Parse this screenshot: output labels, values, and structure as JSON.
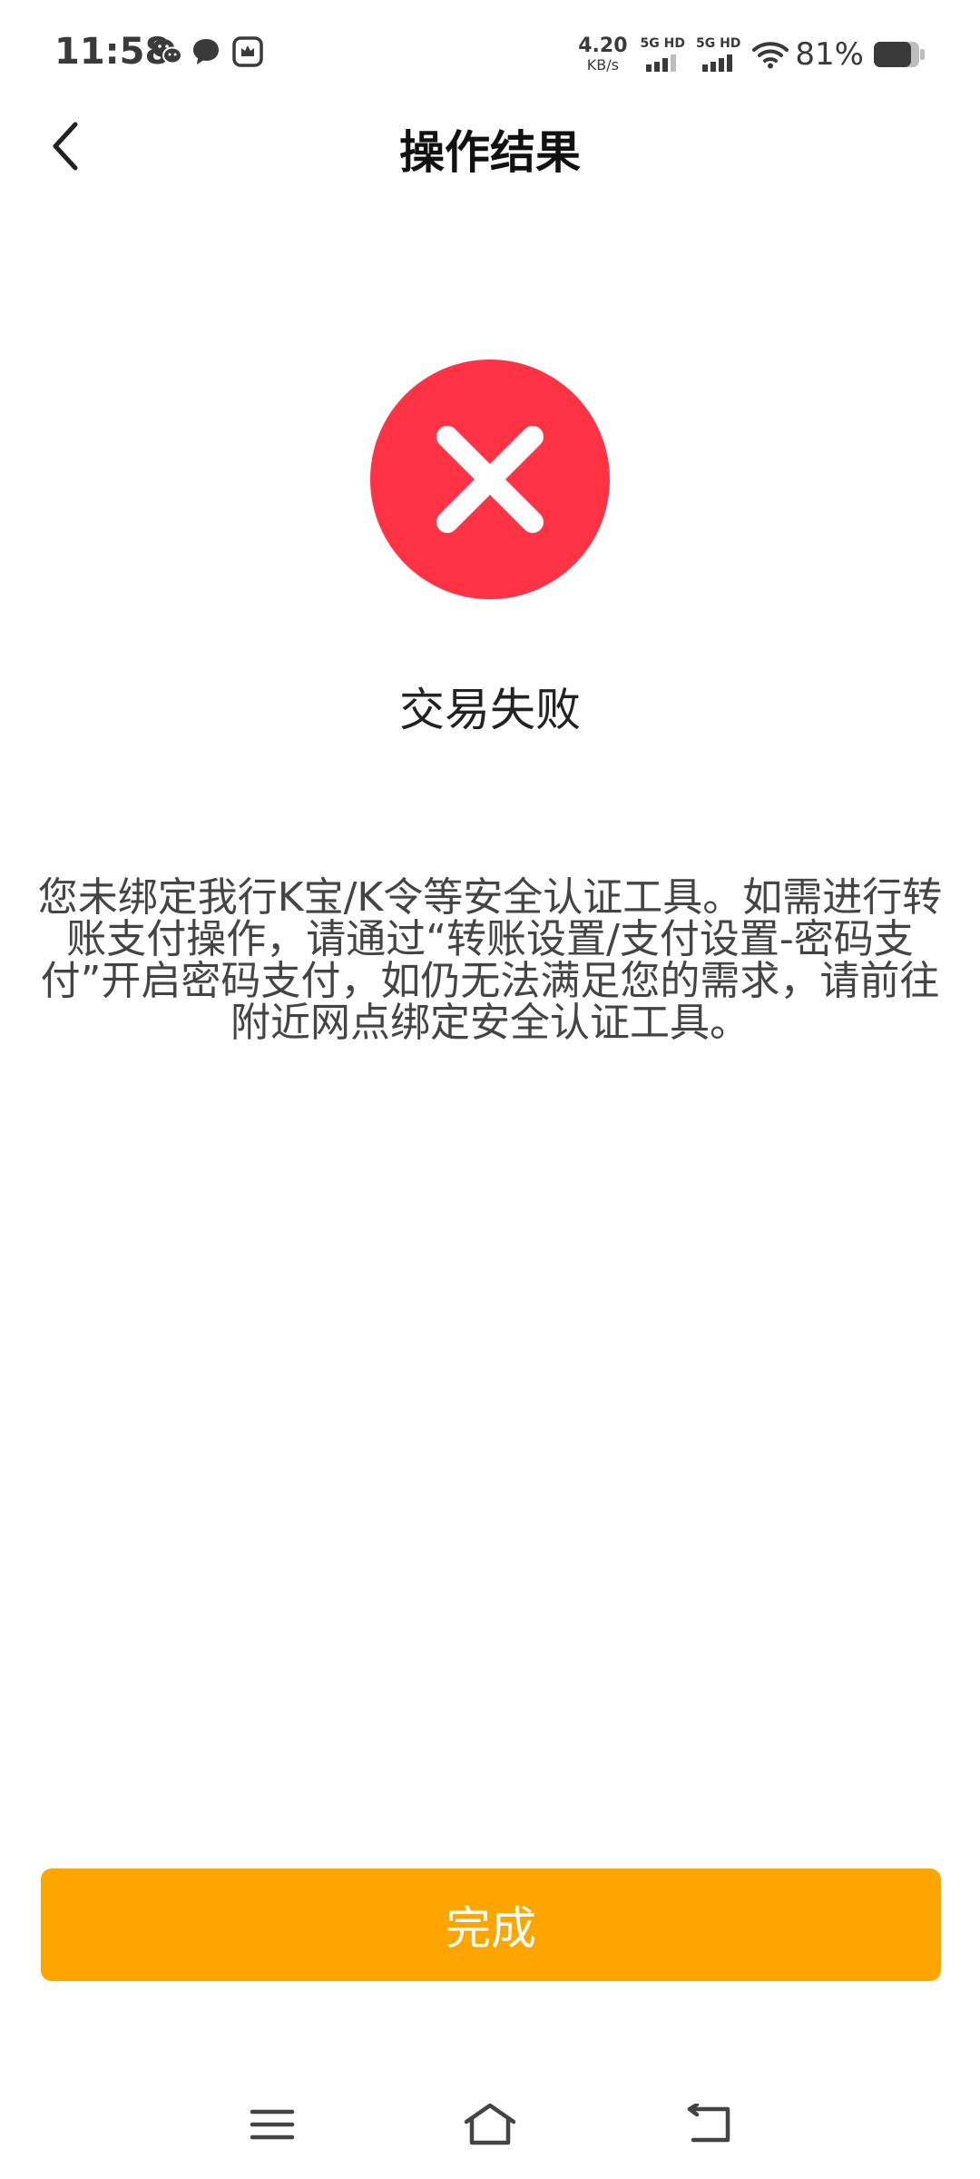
{
  "status_bar": {
    "time": "11:58",
    "net_speed_value": "4.20",
    "net_speed_unit": "KB/s",
    "signal_1_label": "5G HD",
    "signal_2_label": "5G HD",
    "battery_percent": "81%",
    "notification_icons": [
      "wechat-icon",
      "message-icon",
      "app-icon"
    ]
  },
  "nav": {
    "title": "操作结果",
    "back_icon": "chevron-left-icon"
  },
  "result": {
    "status_icon": "error-x-icon",
    "title": "交易失败",
    "message": "您未绑定我行K宝/K令等安全认证工具。如需进行转账支付操作，请通过“转账设置/支付设置-密码支付”开启密码支付，如仍无法满足您的需求，请前往附近网点绑定安全认证工具。"
  },
  "actions": {
    "done_label": "完成"
  },
  "system_nav": [
    "menu-icon",
    "home-icon",
    "back-icon"
  ],
  "colors": {
    "accent": "#FFA500",
    "error": "#FF3344",
    "text_primary": "#111111",
    "text_secondary": "#444444"
  }
}
